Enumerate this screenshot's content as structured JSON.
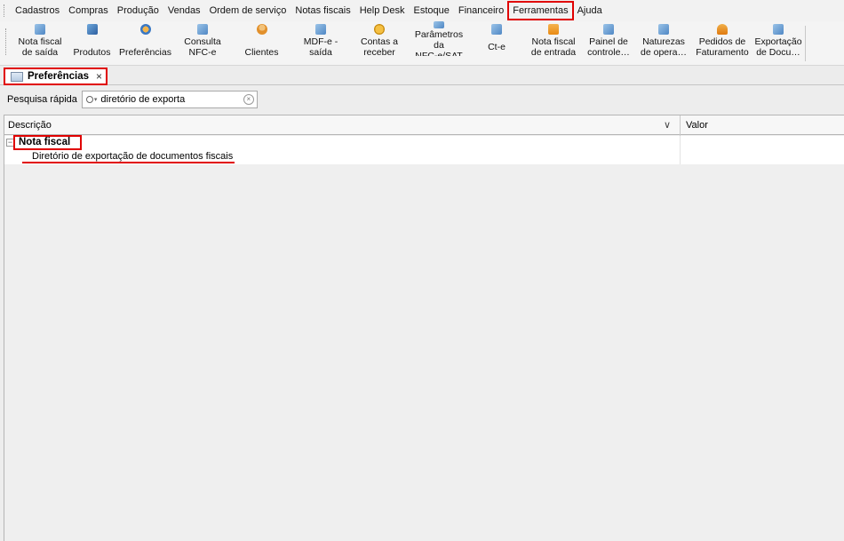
{
  "menu": {
    "items": [
      "Cadastros",
      "Compras",
      "Produção",
      "Vendas",
      "Ordem de serviço",
      "Notas fiscais",
      "Help Desk",
      "Estoque",
      "Financeiro",
      "Ferramentas",
      "Ajuda"
    ],
    "active": "Ferramentas"
  },
  "toolbar": {
    "buttons": [
      {
        "line1": "Nota fiscal",
        "line2": "de saída",
        "icon": "invoice-icon"
      },
      {
        "line1": "",
        "line2": "Produtos",
        "icon": "products-icon"
      },
      {
        "line1": "",
        "line2": "Preferências",
        "icon": "preferences-icon"
      },
      {
        "line1": "Consulta",
        "line2": "NFC-e",
        "icon": "document-icon"
      },
      {
        "line1": "",
        "line2": "Clientes",
        "icon": "user-icon"
      },
      {
        "line1": "MDF-e -",
        "line2": "saída",
        "icon": "document-icon"
      },
      {
        "line1": "Contas a",
        "line2": "receber",
        "icon": "coins-icon"
      },
      {
        "line1": "Parâmetros",
        "line2": "da",
        "line3": "NFC-e/SAT",
        "icon": "document-icon"
      },
      {
        "line1": "",
        "line2": "Ct-e",
        "icon": "document-icon"
      },
      {
        "line1": "Nota fiscal",
        "line2": "de entrada",
        "icon": "folder-icon"
      },
      {
        "line1": "Painel de",
        "line2": "controle…",
        "icon": "document-icon"
      },
      {
        "line1": "Naturezas",
        "line2": "de opera…",
        "icon": "document-icon"
      },
      {
        "line1": "Pedidos de",
        "line2": "Faturamento",
        "icon": "hat-icon"
      },
      {
        "line1": "Exportação",
        "line2": "de Docu…",
        "icon": "document-icon"
      }
    ]
  },
  "tab": {
    "label": "Preferências",
    "close": "×"
  },
  "search": {
    "label": "Pesquisa rápida",
    "value": "diretório de exporta"
  },
  "grid": {
    "columns": {
      "description": "Descrição",
      "value": "Valor"
    },
    "group": {
      "label": "Nota fiscal",
      "expander": "−"
    },
    "items": [
      {
        "description": "Diretório de exportação de documentos fiscais",
        "value": ""
      }
    ]
  },
  "colors": {
    "highlight": "#e00000"
  }
}
